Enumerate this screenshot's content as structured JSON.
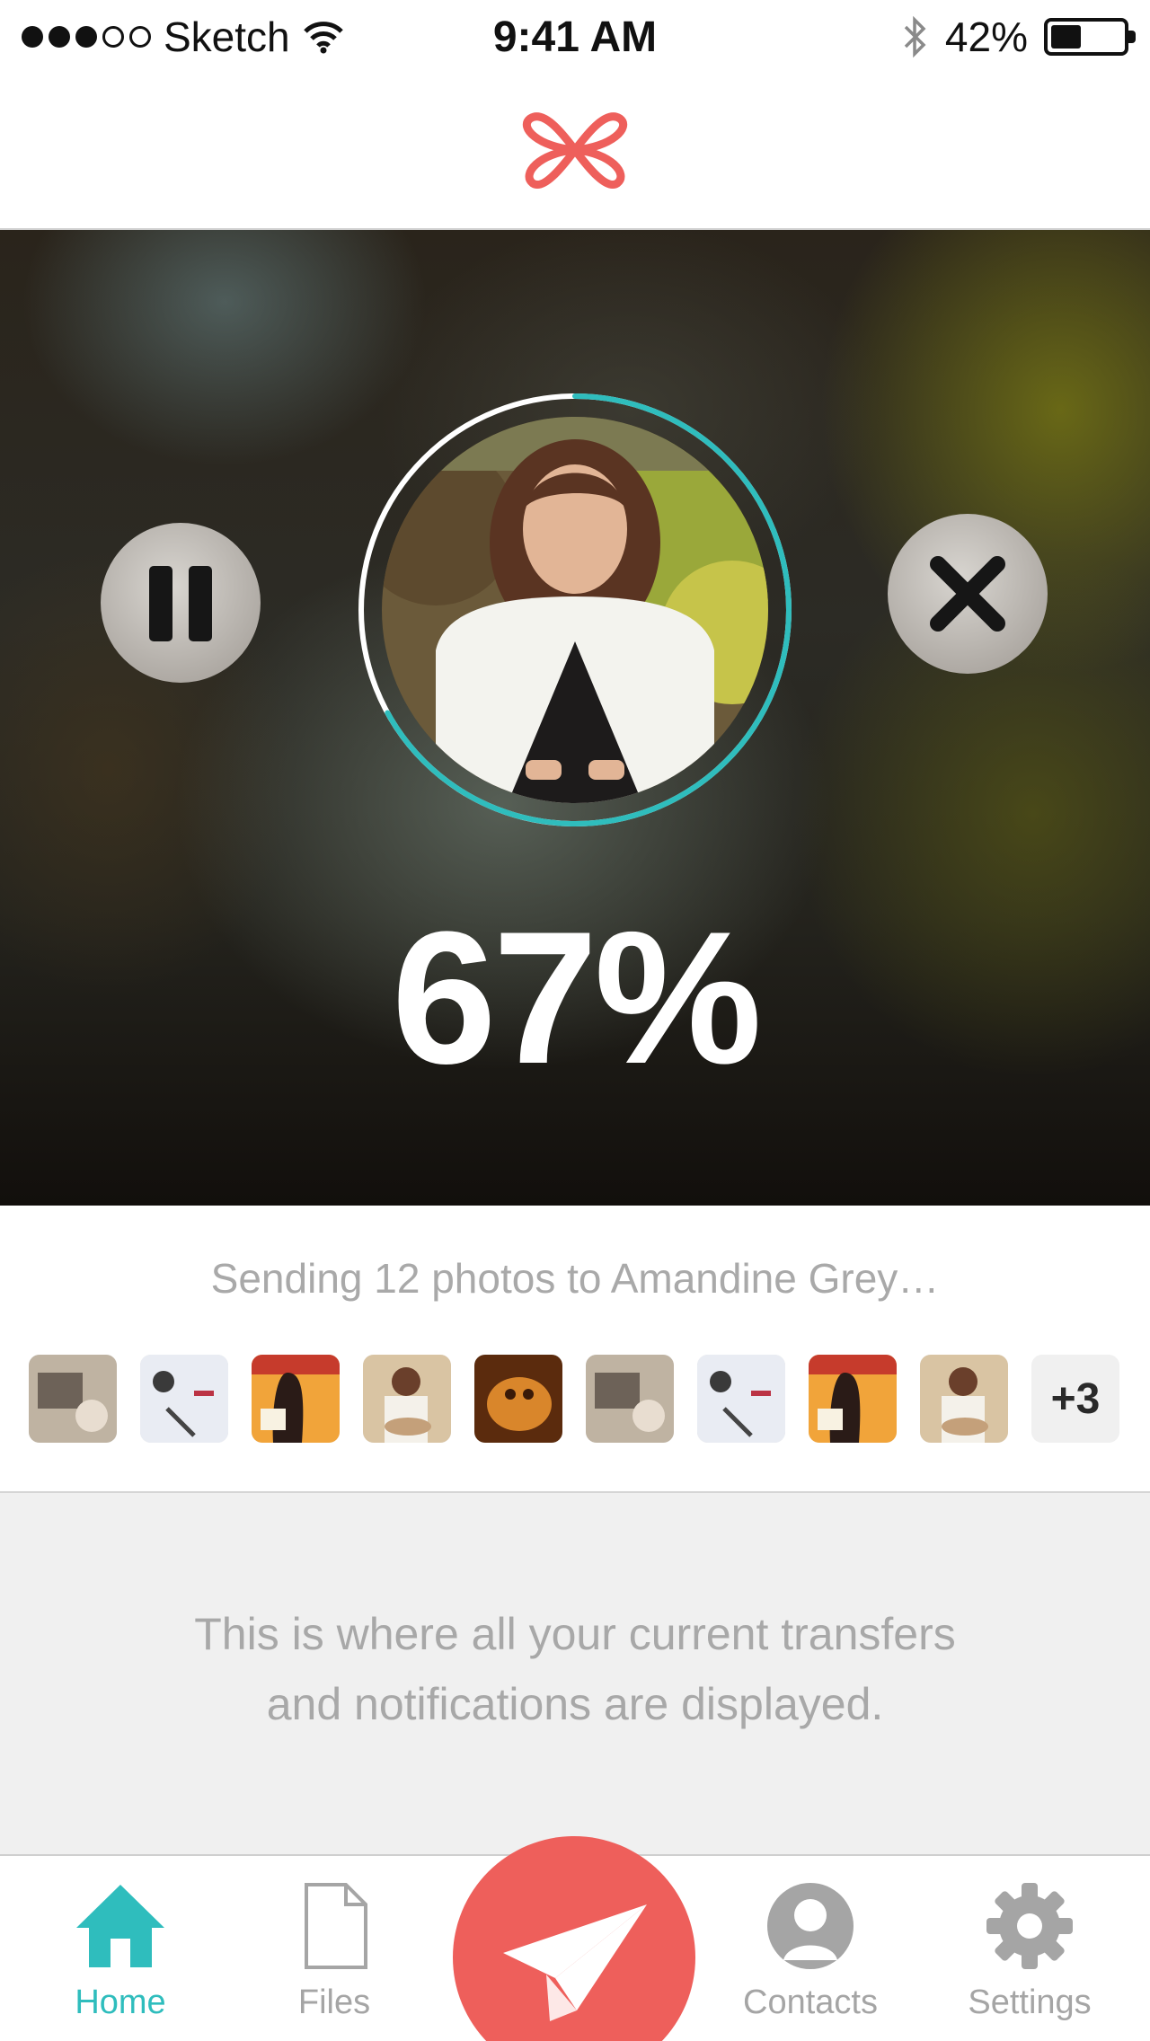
{
  "status_bar": {
    "carrier": "Sketch",
    "time": "9:41 AM",
    "battery_percent": "42%",
    "battery_level": 0.42,
    "signal_bars_filled": 3,
    "signal_bars_total": 5,
    "icons": [
      "wifi-icon",
      "bluetooth-icon",
      "battery-icon"
    ]
  },
  "header": {
    "logo_icon": "clover-logo-icon",
    "brand_color": "#ee5f5b"
  },
  "transfer": {
    "percent_label": "67%",
    "progress": 0.67,
    "progress_color": "#2fbdbd",
    "pause_icon": "pause-icon",
    "cancel_icon": "close-icon",
    "status_text": "Sending 12 photos to Amandine Grey…",
    "thumbnails": [
      {
        "name": "thumb-1"
      },
      {
        "name": "thumb-2"
      },
      {
        "name": "thumb-3"
      },
      {
        "name": "thumb-4"
      },
      {
        "name": "thumb-5"
      },
      {
        "name": "thumb-6"
      },
      {
        "name": "thumb-7"
      },
      {
        "name": "thumb-8"
      },
      {
        "name": "thumb-9"
      }
    ],
    "more_count_label": "+3"
  },
  "notice": {
    "line1": "This is where all your current transfers",
    "line2": "and notifications are displayed."
  },
  "tabbar": {
    "home_label": "Home",
    "files_label": "Files",
    "contacts_label": "Contacts",
    "settings_label": "Settings",
    "send_icon": "paper-plane-icon",
    "active_tab": "Home",
    "active_color": "#2fbdbd",
    "send_color": "#ee5f5b"
  }
}
